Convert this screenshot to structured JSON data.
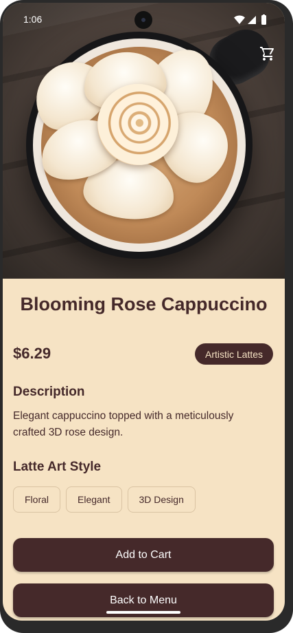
{
  "status_bar": {
    "time": "1:06",
    "icons": [
      "wifi-icon",
      "cellular-signal-icon",
      "battery-icon"
    ]
  },
  "hero": {
    "image": "latte-rose-art-photo",
    "cart_icon": "shopping-cart-icon"
  },
  "product": {
    "title": "Blooming Rose Cappuccino",
    "price": "$6.29",
    "category": "Artistic Lattes",
    "description_heading": "Description",
    "description": "Elegant cappuccino topped with a meticulously crafted 3D rose design.",
    "style_heading": "Latte Art Style",
    "styles": [
      "Floral",
      "Elegant",
      "3D Design"
    ]
  },
  "actions": {
    "add_to_cart": "Add to Cart",
    "back_to_menu": "Back to Menu"
  },
  "colors": {
    "primary": "#45292a",
    "background": "#f6e3c4",
    "on_primary": "#ffffff"
  }
}
